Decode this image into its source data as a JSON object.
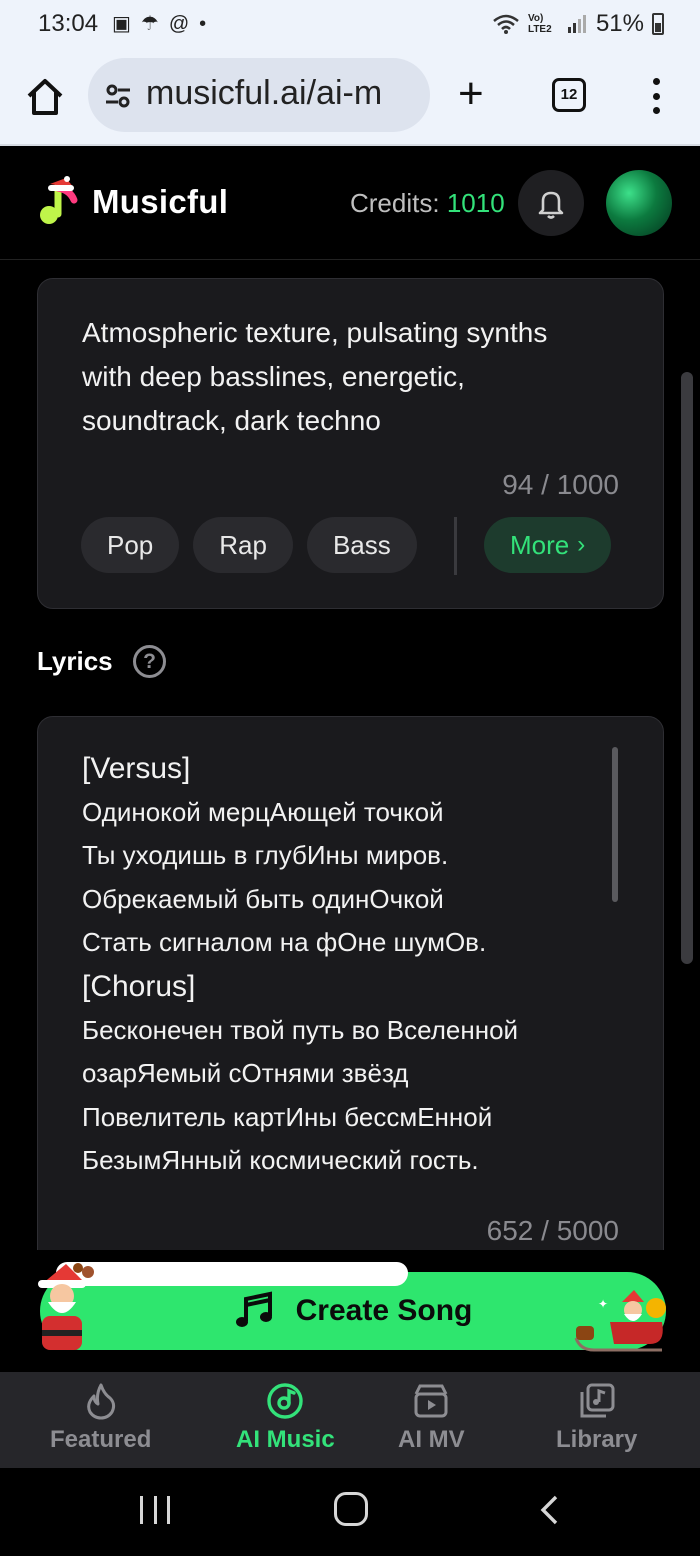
{
  "status_bar": {
    "time": "13:04",
    "notification_icons": [
      "image-icon",
      "umbrella-icon",
      "at-icon",
      "dot-icon"
    ],
    "network": "Vo) LTE2",
    "battery": "51%"
  },
  "browser": {
    "url": "musicful.ai/ai-m",
    "tab_count": "12"
  },
  "app_header": {
    "brand": "Musicful",
    "credits_label": "Credits:",
    "credits_value": "1010"
  },
  "style_prompt": {
    "text": "Atmospheric texture, pulsating synths with deep basslines, energetic, soundtrack, dark techno",
    "char_count": "94 / 1000",
    "genre_chips": [
      "Pop",
      "Rap",
      "Bass"
    ],
    "more_label": "More"
  },
  "lyrics": {
    "section_title": "Lyrics",
    "help_glyph": "?",
    "lines": [
      "[Versus]",
      "Одинокой мерцАющей точкой",
      "Ты уходишь в глубИны миров.",
      "Обрекаемый быть одинОчкой",
      "Стать сигналом на фОне шумОв.",
      "[Chorus]",
      "Бесконечен твой путь во Вселенной",
      "озарЯемый сОтнями звёзд",
      "Повелитель картИны бессмЕнной",
      "БезымЯнный космический гость."
    ],
    "char_count": "652 / 5000"
  },
  "create_button": {
    "label": "Create Song"
  },
  "bottom_nav": {
    "items": [
      {
        "label": "Featured",
        "icon": "flame-icon",
        "active": false
      },
      {
        "label": "AI Music",
        "icon": "music-disc-icon",
        "active": true
      },
      {
        "label": "AI MV",
        "icon": "video-clapper-icon",
        "active": false
      },
      {
        "label": "Library",
        "icon": "library-icon",
        "active": false
      }
    ]
  },
  "colors": {
    "accent": "#33e27a",
    "create_button": "#2ee66e",
    "card_bg": "#1a1a1d",
    "nav_bg": "#26262a"
  }
}
